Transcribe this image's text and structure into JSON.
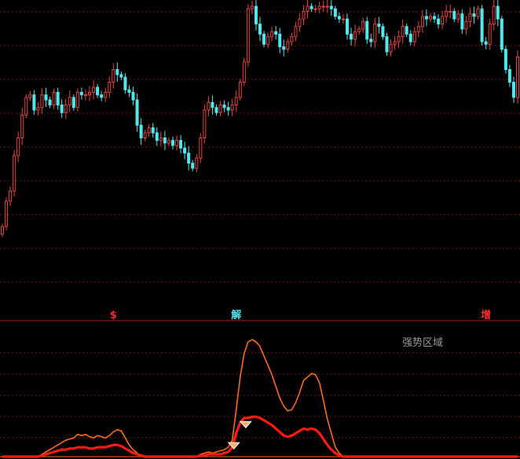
{
  "colors": {
    "background": "#000000",
    "grid": "#7a1414",
    "divider": "#b01818",
    "candle_up": "#e8433d",
    "candle_down": "#4ee8ee",
    "osc_outer": "#ff6a10",
    "osc_inner": "#ff1a10",
    "marker_red": "#ff2a2a",
    "marker_cyan": "#4ee8ee",
    "region_label": "#9a9a9a",
    "diamond": "#f6b06a"
  },
  "markers": [
    {
      "label": "$",
      "color": "#ff2a2a",
      "x_index": 28
    },
    {
      "label": "解",
      "color": "#4ee8ee",
      "x_index": 59
    },
    {
      "label": "增",
      "color": "#ff2a2a",
      "x_index": 122
    }
  ],
  "region_label": "强势区域",
  "chart_data": [
    {
      "type": "candlestick",
      "title": "",
      "xlabel": "",
      "ylabel": "",
      "ylim": [
        0,
        100
      ],
      "grid": true,
      "close": [
        13,
        23,
        27,
        41,
        48,
        57,
        64,
        65,
        59,
        60,
        65,
        63,
        61,
        66,
        61,
        58,
        61,
        64,
        60,
        66,
        65,
        65,
        66,
        68,
        65,
        64,
        66,
        70,
        75,
        73,
        72,
        67,
        66,
        63,
        53,
        48,
        50,
        52,
        50,
        47,
        48,
        46,
        47,
        45,
        47,
        44,
        42,
        38,
        36,
        40,
        48,
        59,
        62,
        60,
        58,
        61,
        60,
        59,
        61,
        64,
        70,
        78,
        99,
        100,
        93,
        89,
        85,
        88,
        90,
        89,
        84,
        83,
        86,
        88,
        92,
        95,
        98,
        100,
        99,
        99,
        100,
        100,
        100,
        99,
        96,
        95,
        95,
        89,
        87,
        90,
        91,
        94,
        87,
        86,
        93,
        92,
        88,
        82,
        85,
        86,
        88,
        92,
        89,
        86,
        90,
        92,
        96,
        95,
        96,
        95,
        93,
        96,
        98,
        98,
        95,
        97,
        91,
        94,
        97,
        96,
        99,
        86,
        85,
        93,
        100,
        95,
        83,
        75,
        70,
        64,
        80
      ],
      "open": [
        10,
        13,
        23,
        27,
        41,
        48,
        57,
        64,
        65,
        59,
        60,
        65,
        63,
        61,
        66,
        61,
        58,
        61,
        64,
        60,
        66,
        65,
        65,
        66,
        68,
        65,
        64,
        66,
        70,
        75,
        73,
        72,
        67,
        66,
        63,
        53,
        48,
        50,
        52,
        50,
        47,
        48,
        46,
        47,
        45,
        47,
        44,
        42,
        38,
        36,
        40,
        48,
        59,
        62,
        60,
        58,
        61,
        60,
        59,
        61,
        64,
        70,
        78,
        99,
        100,
        93,
        89,
        85,
        88,
        90,
        89,
        84,
        83,
        86,
        88,
        92,
        95,
        98,
        100,
        99,
        99,
        100,
        100,
        100,
        99,
        96,
        95,
        95,
        89,
        87,
        90,
        91,
        94,
        87,
        86,
        93,
        92,
        88,
        82,
        85,
        86,
        88,
        92,
        89,
        86,
        90,
        92,
        96,
        95,
        96,
        95,
        93,
        96,
        98,
        98,
        95,
        97,
        91,
        94,
        97,
        96,
        99,
        86,
        85,
        93,
        100,
        95,
        83,
        75,
        70,
        64
      ]
    },
    {
      "type": "line",
      "title": "",
      "xlabel": "",
      "ylabel": "",
      "ylim": [
        0,
        100
      ],
      "grid": true,
      "series": [
        {
          "values": [
            0,
            0,
            0,
            0,
            0,
            0,
            0,
            0,
            0,
            0,
            2,
            4,
            6,
            8,
            10,
            12,
            14,
            15,
            16,
            19,
            18,
            19,
            17,
            16,
            18,
            17,
            16,
            18,
            21,
            23,
            22,
            16,
            10,
            6,
            3,
            1,
            0,
            0,
            0,
            0,
            0,
            0,
            0,
            0,
            0,
            0,
            0,
            0,
            0,
            0,
            2,
            3,
            4,
            3,
            4,
            5,
            6,
            8,
            14,
            40,
            68,
            88,
            98,
            100,
            98,
            94,
            86,
            78,
            70,
            60,
            50,
            43,
            39,
            40,
            46,
            55,
            65,
            68,
            71,
            70,
            63,
            48,
            32,
            20,
            8,
            3,
            0,
            0,
            0,
            0,
            0,
            0,
            0,
            0,
            0,
            0,
            0,
            0,
            0,
            0,
            0,
            0,
            0,
            0,
            0,
            0,
            0,
            0,
            0,
            0,
            0,
            0,
            0,
            0,
            0,
            0,
            0,
            0,
            0,
            0,
            0,
            0,
            0,
            0,
            0,
            0,
            0,
            0,
            0,
            0,
            0
          ]
        },
        {
          "values": [
            0,
            0,
            0,
            0,
            0,
            0,
            0,
            0,
            0,
            0,
            1,
            2,
            3,
            4,
            5,
            6,
            6,
            7,
            7,
            8,
            8,
            8,
            7,
            7,
            8,
            8,
            8,
            9,
            10,
            10,
            9,
            7,
            5,
            3,
            2,
            1,
            0,
            0,
            0,
            0,
            0,
            0,
            0,
            0,
            0,
            0,
            0,
            0,
            0,
            0,
            1,
            1,
            2,
            2,
            2,
            2,
            3,
            4,
            8,
            20,
            29,
            33,
            33,
            34,
            34,
            33,
            31,
            29,
            27,
            24,
            21,
            18,
            17,
            18,
            20,
            22,
            24,
            23,
            24,
            23,
            20,
            15,
            10,
            6,
            3,
            1,
            0,
            0,
            0,
            0,
            0,
            0,
            0,
            0,
            0,
            0,
            0,
            0,
            0,
            0,
            0,
            0,
            0,
            0,
            0,
            0,
            0,
            0,
            0,
            0,
            0,
            0,
            0,
            0,
            0,
            0,
            0,
            0,
            0,
            0,
            0,
            0,
            0,
            0,
            0,
            0,
            0,
            0,
            0,
            0,
            0
          ]
        }
      ]
    }
  ]
}
